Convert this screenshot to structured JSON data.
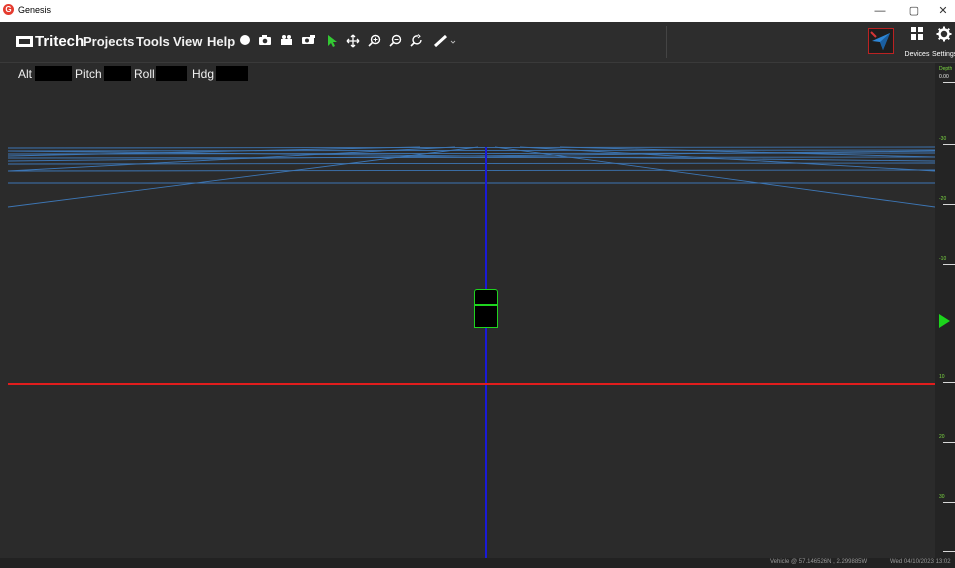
{
  "window": {
    "title": "Genesis",
    "logo_glyph": "G",
    "minimize": "—",
    "maximize": "▢",
    "close": "✕"
  },
  "menubar": {
    "brand": "Tritech",
    "menus": [
      "Projects",
      "Tools",
      "View",
      "Help"
    ],
    "tools": [
      "record-icon",
      "camera-icon",
      "video-icon",
      "sonar-snapshot-icon",
      "select-pointer-icon",
      "pan-icon",
      "zoom-in-icon",
      "zoom-out-icon",
      "zoom-reset-icon",
      "measure-icon"
    ],
    "devices_label": "Devices",
    "settings_label": "Settings"
  },
  "orientation": {
    "alt": "Alt",
    "pitch": "Pitch",
    "roll": "Roll",
    "hdg": "Hdg"
  },
  "ruler": {
    "title": "Depth",
    "top_value": "0.00",
    "labels": [
      "-30",
      "-20",
      "-10",
      "10",
      "20",
      "30"
    ]
  },
  "status": {
    "vehicle": "Vehicle @ 57.146526N , 2.299885W",
    "datetime": "Wed 04/10/2023 13:02"
  },
  "colors": {
    "grid": "#3f7fc4",
    "waterline": "#e11d1d",
    "vertical_axis": "#1a1ad6",
    "vehicle": "#1fd41f"
  }
}
